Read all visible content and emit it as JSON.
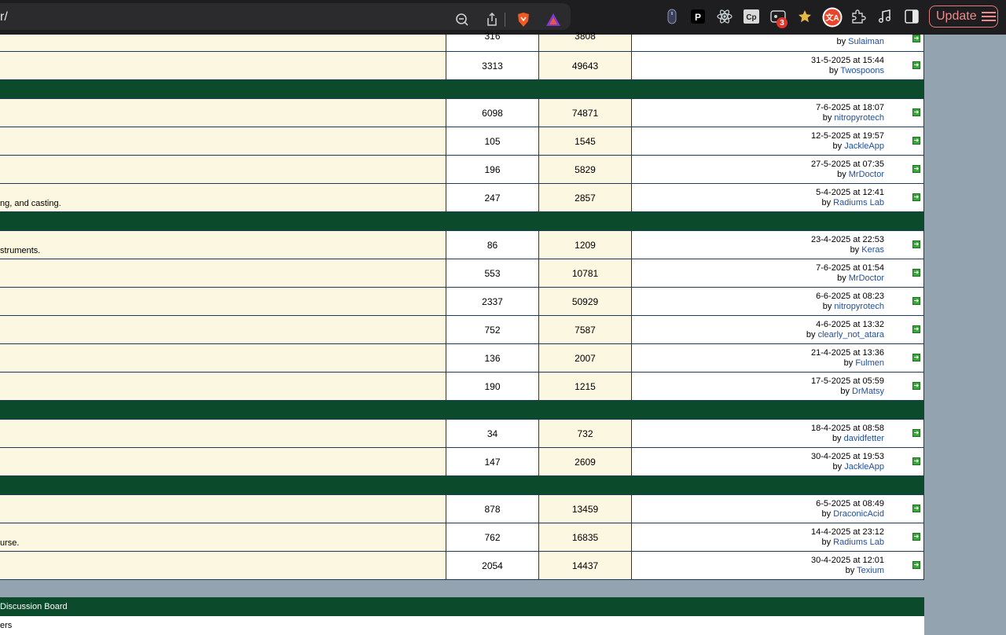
{
  "browser": {
    "url_fragment": "r/",
    "extension_badge": "3",
    "update_label": "Update",
    "icons": [
      "zoom-out-icon",
      "share-icon",
      "brave-shield-icon",
      "brave-rewards-icon",
      "mouse-icon",
      "p-extension-icon",
      "react-icon",
      "cp-extension-icon",
      "sync-extension-icon",
      "star-icon",
      "translate-extension-icon",
      "puzzle-icon",
      "music-icon",
      "sidebar-icon",
      "hamburger-icon"
    ]
  },
  "forum": {
    "first_row": {
      "topics": "316",
      "posts": "3808",
      "by_prefix": "by",
      "user": "Sulaiman"
    },
    "sections": [
      {
        "rows": [
          {
            "desc": "",
            "topics": "3313",
            "posts": "49643",
            "date": "31-5-2025 at 15:44",
            "user": "Twospoons"
          }
        ]
      },
      {
        "rows": [
          {
            "desc": "",
            "topics": "6098",
            "posts": "74871",
            "date": "7-6-2025 at 18:07",
            "user": "nitropyrotech"
          },
          {
            "desc": "",
            "topics": "105",
            "posts": "1545",
            "date": "12-5-2025 at 19:57",
            "user": "JackleApp"
          },
          {
            "desc": "",
            "topics": "196",
            "posts": "5829",
            "date": "27-5-2025 at 07:35",
            "user": "MrDoctor"
          },
          {
            "desc": "ng, and casting.",
            "topics": "247",
            "posts": "2857",
            "date": "5-4-2025 at 12:41",
            "user": "Radiums Lab"
          }
        ]
      },
      {
        "rows": [
          {
            "desc": "struments.",
            "topics": "86",
            "posts": "1209",
            "date": "23-4-2025 at 22:53",
            "user": "Keras"
          },
          {
            "desc": "",
            "topics": "553",
            "posts": "10781",
            "date": "7-6-2025 at 01:54",
            "user": "MrDoctor"
          },
          {
            "desc": "",
            "topics": "2337",
            "posts": "50929",
            "date": "6-6-2025 at 08:23",
            "user": "nitropyrotech"
          },
          {
            "desc": "",
            "topics": "752",
            "posts": "7587",
            "date": "4-6-2025 at 13:32",
            "user": "clearly_not_atara"
          },
          {
            "desc": "",
            "topics": "136",
            "posts": "2007",
            "date": "21-4-2025 at 13:36",
            "user": "Fulmen"
          },
          {
            "desc": "",
            "topics": "190",
            "posts": "1215",
            "date": "17-5-2025 at 05:59",
            "user": "DrMatsy"
          }
        ]
      },
      {
        "rows": [
          {
            "desc": "",
            "topics": "34",
            "posts": "732",
            "date": "18-4-2025 at 08:58",
            "user": "davidfetter"
          },
          {
            "desc": "",
            "topics": "147",
            "posts": "2609",
            "date": "30-4-2025 at 19:53",
            "user": "JackleApp"
          }
        ]
      },
      {
        "rows": [
          {
            "desc": "",
            "topics": "878",
            "posts": "13459",
            "date": "6-5-2025 at 08:49",
            "user": "DraconicAcid"
          },
          {
            "desc": "urse.",
            "topics": "762",
            "posts": "16835",
            "date": "14-4-2025 at 23:12",
            "user": "Radiums Lab"
          },
          {
            "desc": "",
            "topics": "2054",
            "posts": "14437",
            "date": "30-4-2025 at 12:01",
            "user": "Texium"
          }
        ]
      }
    ],
    "by_prefix": "by"
  },
  "footer": {
    "bar_title": "Discussion Board",
    "row_text": "ers"
  },
  "colors": {
    "category_bar": "#0b4a2a",
    "cell_cream": "#fbf7e0",
    "link_blue": "#1f4fa0",
    "page_bg": "#93a4b0"
  }
}
